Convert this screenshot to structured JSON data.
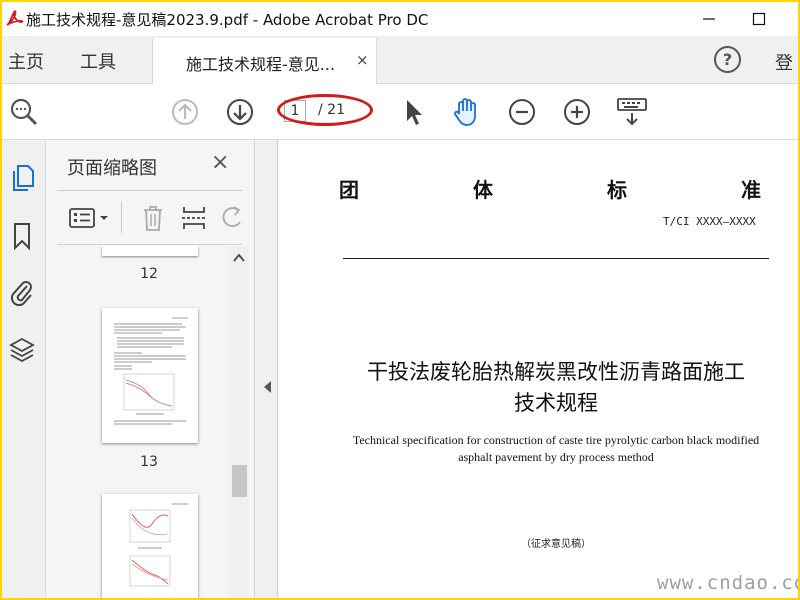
{
  "window": {
    "title": "施工技术规程-意见稿2023.9.pdf - Adobe Acrobat Pro DC",
    "minimize_label": "—",
    "maximize_label": "☐"
  },
  "menubar": {
    "home": "主页",
    "tools": "工具",
    "doc_tab_label": "施工技术规程-意见...",
    "doc_tab_close": "×",
    "help": "?",
    "login": "登"
  },
  "toolbar": {
    "current_page": "1",
    "page_total": "/ 21",
    "icons": [
      "search-icon",
      "prev-page-icon",
      "next-page-icon",
      "select-arrow-icon",
      "hand-icon",
      "zoom-out-icon",
      "zoom-in-icon",
      "keyboard-icon"
    ],
    "accent_color": "#1a73e8",
    "highlight_color": "#d21a1a"
  },
  "leftrail": {
    "icons": [
      "page-thumbnails-icon",
      "bookmark-icon",
      "attachment-icon",
      "layers-icon"
    ]
  },
  "thumbnail_panel": {
    "title": "页面缩略图",
    "close": "×",
    "pages": [
      {
        "label": "12"
      },
      {
        "label": "13"
      },
      {
        "label": ""
      }
    ]
  },
  "document": {
    "heading_chars": [
      "团",
      "体",
      "标",
      "准"
    ],
    "code": "T/CI XXXX—XXXX",
    "title_line1": "干投法废轮胎热解炭黑改性沥青路面施工",
    "title_line2": "技术规程",
    "english_line1": "Technical specification for construction of  caste tire pyrolytic carbon black modified",
    "english_line2": "asphalt pavement by dry process method",
    "draft_label": "（征求意见稿）"
  },
  "watermark": "www.cndao.com"
}
